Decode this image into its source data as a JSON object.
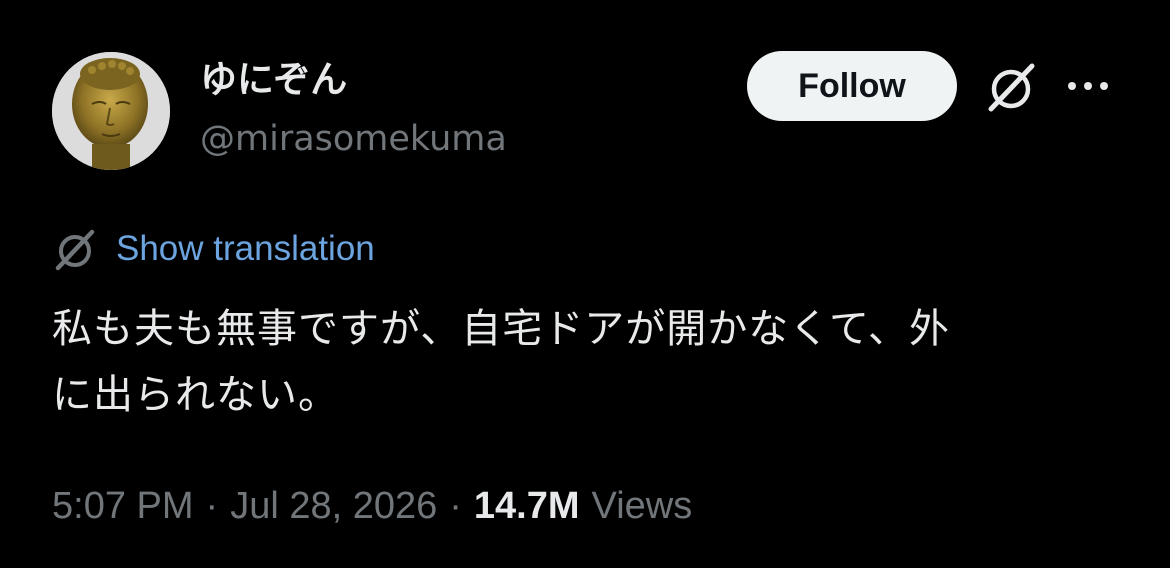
{
  "author": {
    "display_name": "ゆにぞん",
    "handle": "@mirasomekuma",
    "avatar_icon": "golden-buddha-statue-avatar"
  },
  "actions": {
    "follow_label": "Follow",
    "grok_icon": "grok-slash-circle-icon",
    "more_icon": "more-horizontal-icon"
  },
  "translation": {
    "icon": "grok-translate-icon",
    "label": "Show translation"
  },
  "tweet": {
    "line1": "私も夫も無事ですが、自宅ドアが開かなくて、外",
    "line2": "に出られない。"
  },
  "meta": {
    "time": "5:07 PM",
    "separator": "·",
    "date": "Jul 28, 2026",
    "views_count": "14.7M",
    "views_label": "Views"
  },
  "colors": {
    "background": "#000000",
    "primary_text": "#e7e9ea",
    "secondary_text": "#71767b",
    "link": "#6ca4e0",
    "follow_button_bg": "#eff3f4"
  }
}
